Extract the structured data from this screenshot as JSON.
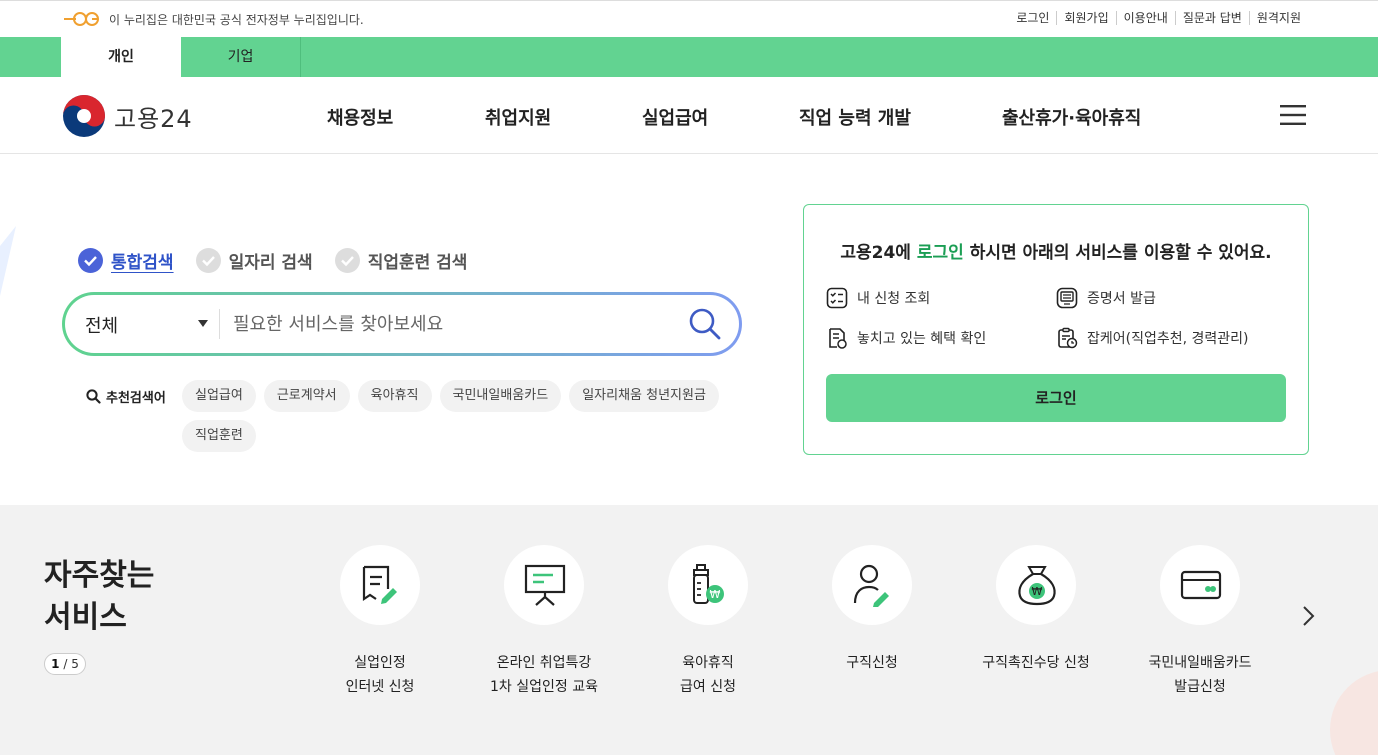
{
  "gov_bar": {
    "text": "이 누리집은 대한민국 공식 전자정부 누리집입니다.",
    "links": [
      "로그인",
      "회원가입",
      "이용안내",
      "질문과 답변",
      "원격지원"
    ]
  },
  "tabs": [
    "개인",
    "기업"
  ],
  "header": {
    "logo_text": "고용24",
    "nav": [
      "채용정보",
      "취업지원",
      "실업급여",
      "직업 능력 개발",
      "출산휴가·육아휴직"
    ]
  },
  "search": {
    "types": [
      "통합검색",
      "일자리 검색",
      "직업훈련 검색"
    ],
    "active_type": "통합검색",
    "scope": "전체",
    "placeholder": "필요한 서비스를 찾아보세요",
    "recommend_label": "추천검색어",
    "keywords": [
      "실업급여",
      "근로계약서",
      "육아휴직",
      "국민내일배움카드",
      "일자리채움 청년지원금",
      "직업훈련"
    ]
  },
  "login_card": {
    "title_prefix": "고용24에 ",
    "title_highlight": "로그인",
    "title_suffix": " 하시면 아래의 서비스를 이용할 수 있어요.",
    "items": [
      "내 신청 조회",
      "증명서 발급",
      "놓치고 있는 혜택 확인",
      "잡케어(직업추천, 경력관리)"
    ],
    "button": "로그인"
  },
  "frequent": {
    "title_line1": "자주찾는",
    "title_line2": "서비스",
    "page_current": "1",
    "page_total": "5",
    "services": [
      {
        "line1": "실업인정",
        "line2": "인터넷 신청",
        "icon": "document-edit-icon"
      },
      {
        "line1": "온라인 취업특강",
        "line2": "1차 실업인정 교육",
        "icon": "presentation-board-icon"
      },
      {
        "line1": "육아휴직",
        "line2": "급여 신청",
        "icon": "baby-bottle-won-icon"
      },
      {
        "line1": "구직신청",
        "line2": "",
        "icon": "person-edit-icon"
      },
      {
        "line1": "구직촉진수당 신청",
        "line2": "",
        "icon": "money-bag-icon"
      },
      {
        "line1": "국민내일배움카드",
        "line2": "발급신청",
        "icon": "card-icon"
      }
    ]
  },
  "colors": {
    "brand_green": "#62d391",
    "accent_blue": "#2f53c8",
    "highlight_green": "#1b9e54"
  }
}
